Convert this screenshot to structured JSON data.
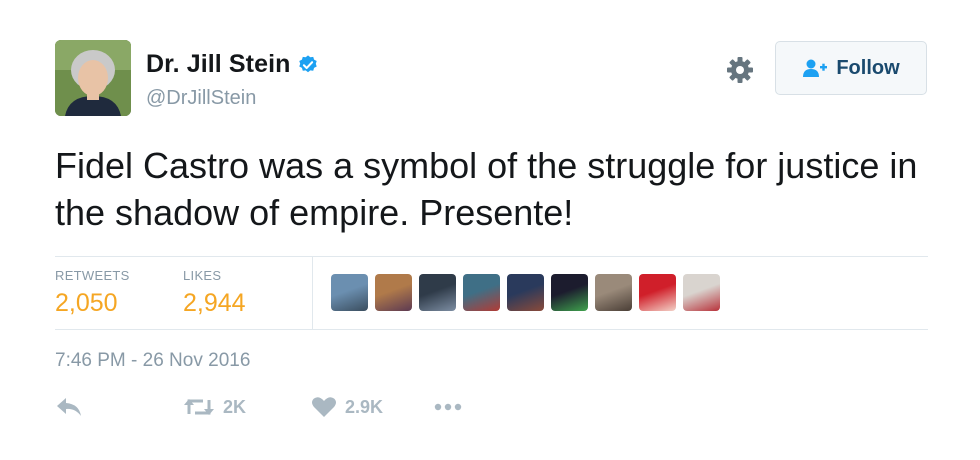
{
  "tweet": {
    "author_name": "Dr. Jill Stein",
    "author_handle": "@DrJillStein",
    "text": "Fidel Castro was a symbol of the struggle for justice in the shadow of empire. Presente!",
    "timestamp": "7:46 PM - 26 Nov 2016",
    "verified": true
  },
  "follow_button": {
    "label": "Follow"
  },
  "stats": {
    "retweets_label": "RETWEETS",
    "retweets_value": "2,050",
    "likes_label": "LIKES",
    "likes_value": "2,944"
  },
  "likers": [
    {
      "name": "liker-1",
      "colors": [
        "#6b8fb0",
        "#3a4d5e"
      ]
    },
    {
      "name": "liker-2",
      "colors": [
        "#b07a4a",
        "#5d3a52"
      ]
    },
    {
      "name": "liker-3",
      "colors": [
        "#2f3b49",
        "#7d8ea3"
      ]
    },
    {
      "name": "liker-4",
      "colors": [
        "#3f6f86",
        "#b23b35"
      ]
    },
    {
      "name": "liker-5",
      "colors": [
        "#2a3a5c",
        "#8a4a3a"
      ]
    },
    {
      "name": "liker-6",
      "colors": [
        "#1c1c2e",
        "#3fa34d"
      ]
    },
    {
      "name": "liker-7",
      "colors": [
        "#9a8a7a",
        "#4a3e36"
      ]
    },
    {
      "name": "liker-8",
      "colors": [
        "#d01f2a",
        "#f3d2c8"
      ]
    },
    {
      "name": "liker-9",
      "colors": [
        "#d9d4cf",
        "#b8323a"
      ]
    }
  ],
  "actions": {
    "reply_icon": "reply-icon",
    "retweet_icon": "retweet-icon",
    "retweet_count": "2K",
    "like_icon": "heart-icon",
    "like_count": "2.9K",
    "more_icon": "more-icon"
  },
  "colors": {
    "accent_count": "#f5a623",
    "muted": "#8899a6",
    "verified_blue": "#1da1f2",
    "follow_text": "#1a4a6e"
  }
}
